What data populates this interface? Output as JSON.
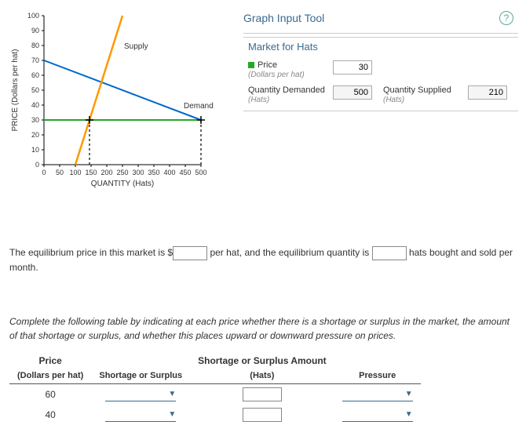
{
  "tool": {
    "title": "Graph Input Tool",
    "help_label": "?",
    "market_title": "Market for Hats",
    "price_label": "Price",
    "price_sub": "(Dollars per hat)",
    "price_value": "30",
    "qd_label": "Quantity Demanded",
    "qd_sub": "(Hats)",
    "qd_value": "500",
    "qs_label": "Quantity Supplied",
    "qs_sub": "(Hats)",
    "qs_value": "210"
  },
  "chart_data": {
    "type": "line",
    "title": "",
    "xlabel": "QUANTITY (Hats)",
    "ylabel": "PRICE (Dollars per hat)",
    "xlim": [
      0,
      500
    ],
    "ylim": [
      0,
      100
    ],
    "x_ticks": [
      0,
      50,
      100,
      150,
      200,
      250,
      300,
      350,
      400,
      450,
      500
    ],
    "y_ticks": [
      0,
      10,
      20,
      30,
      40,
      50,
      60,
      70,
      80,
      90,
      100
    ],
    "series": [
      {
        "name": "Supply",
        "x": [
          100,
          250
        ],
        "y": [
          0,
          100
        ],
        "color": "#f90"
      },
      {
        "name": "Demand",
        "x": [
          0,
          500
        ],
        "y": [
          70,
          30
        ],
        "color": "#06c"
      }
    ],
    "horizontal_marker": {
      "name": "Price",
      "y": 30,
      "x_range": [
        0,
        500
      ],
      "color": "#2a2"
    },
    "marker_points": [
      {
        "x": 145,
        "y": 30,
        "drop_to_x_axis": true
      },
      {
        "x": 500,
        "y": 30,
        "drop_to_x_axis": true
      }
    ]
  },
  "question1": {
    "pre": "The equilibrium price in this market is",
    "dollar": "$",
    "mid": "per hat, and the equilibrium quantity is",
    "post": "hats bought and sold per month."
  },
  "instruction": "Complete the following table by indicating at each price whether there is a shortage or surplus in the market, the amount of that shortage or surplus, and whether this places upward or downward pressure on prices.",
  "table": {
    "h_price": "Price",
    "h_price_sub": "(Dollars per hat)",
    "h_ss": "Shortage or Surplus",
    "h_amt": "Shortage or Surplus Amount",
    "h_amt_sub": "(Hats)",
    "h_pressure": "Pressure",
    "rows": [
      {
        "price": "60"
      },
      {
        "price": "40"
      }
    ]
  }
}
